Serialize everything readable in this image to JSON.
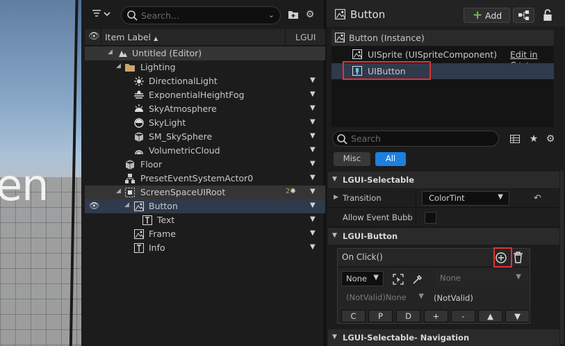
{
  "viewport": {
    "overlay_text": "en"
  },
  "outliner": {
    "search_placeholder": "Search...",
    "column_label": "Item Label",
    "column_sort_indicator": "▲",
    "column_lgui": "LGUI",
    "rows": [
      {
        "label": "Untitled (Editor)",
        "icon": "level-icon"
      },
      {
        "label": "Lighting",
        "icon": "folder-icon"
      },
      {
        "label": "DirectionalLight",
        "icon": "directional-light-icon"
      },
      {
        "label": "ExponentialHeightFog",
        "icon": "fog-icon"
      },
      {
        "label": "SkyAtmosphere",
        "icon": "sky-atmosphere-icon"
      },
      {
        "label": "SkyLight",
        "icon": "skylight-icon"
      },
      {
        "label": "SM_SkySphere",
        "icon": "static-mesh-icon"
      },
      {
        "label": "VolumetricCloud",
        "icon": "cloud-icon"
      },
      {
        "label": "Floor",
        "icon": "static-mesh-icon"
      },
      {
        "label": "PresetEventSystemActor0",
        "icon": "actor-icon"
      },
      {
        "label": "ScreenSpaceUIRoot",
        "icon": "ui-root-icon",
        "badge": "2"
      },
      {
        "label": "Button",
        "icon": "sprite-icon"
      },
      {
        "label": "Text",
        "icon": "text-icon"
      },
      {
        "label": "Frame",
        "icon": "sprite-icon"
      },
      {
        "label": "Info",
        "icon": "text-icon"
      }
    ]
  },
  "details": {
    "title": "Button",
    "add_label": "Add",
    "components": {
      "instance": "Button (Instance)",
      "sprite": "UISprite (UISpriteComponent)",
      "edit_link": "Edit in C++",
      "button": "UIButton"
    },
    "search_placeholder": "Search",
    "filters": [
      "Misc",
      "All"
    ],
    "categories": {
      "selectable": "LGUI-Selectable",
      "button": "LGUI-Button",
      "navigation": "LGUI-Selectable- Navigation"
    },
    "properties": {
      "transition_label": "Transition",
      "transition_value": "ColorTint",
      "allow_event_label": "Allow Event Bubbl..."
    },
    "onclick": {
      "title": "On Click()",
      "target_value": "None",
      "function_value": "None",
      "param_type": "(NotValid)None",
      "param_value": "(NotValid)",
      "param_buttons": [
        "C",
        "P",
        "D",
        "+",
        "-",
        "▲",
        "▼"
      ]
    }
  }
}
